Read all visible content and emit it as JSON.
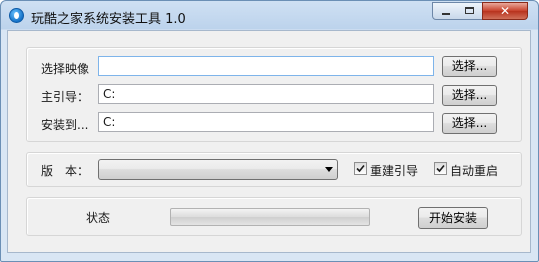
{
  "window": {
    "title": "玩酷之家系统安装工具 1.0",
    "close_glyph": "✕",
    "icon": "app-drop-icon"
  },
  "source": {
    "image_label": "选择映像",
    "image_value": "",
    "boot_label": "主引导：",
    "boot_value": "C:",
    "install_label": "安装到...",
    "install_value": "C:",
    "browse_label": "选择..."
  },
  "options": {
    "version_label": "版　本：",
    "version_value": "",
    "rebuild_boot_label": "重建引导",
    "rebuild_boot_checked": true,
    "auto_restart_label": "自动重启",
    "auto_restart_checked": true
  },
  "status": {
    "label": "状态",
    "progress_percent": 0,
    "start_label": "开始安装"
  },
  "colors": {
    "accent": "#1572c8",
    "focus_border": "#7eb4ea",
    "close_red": "#c7402a"
  }
}
